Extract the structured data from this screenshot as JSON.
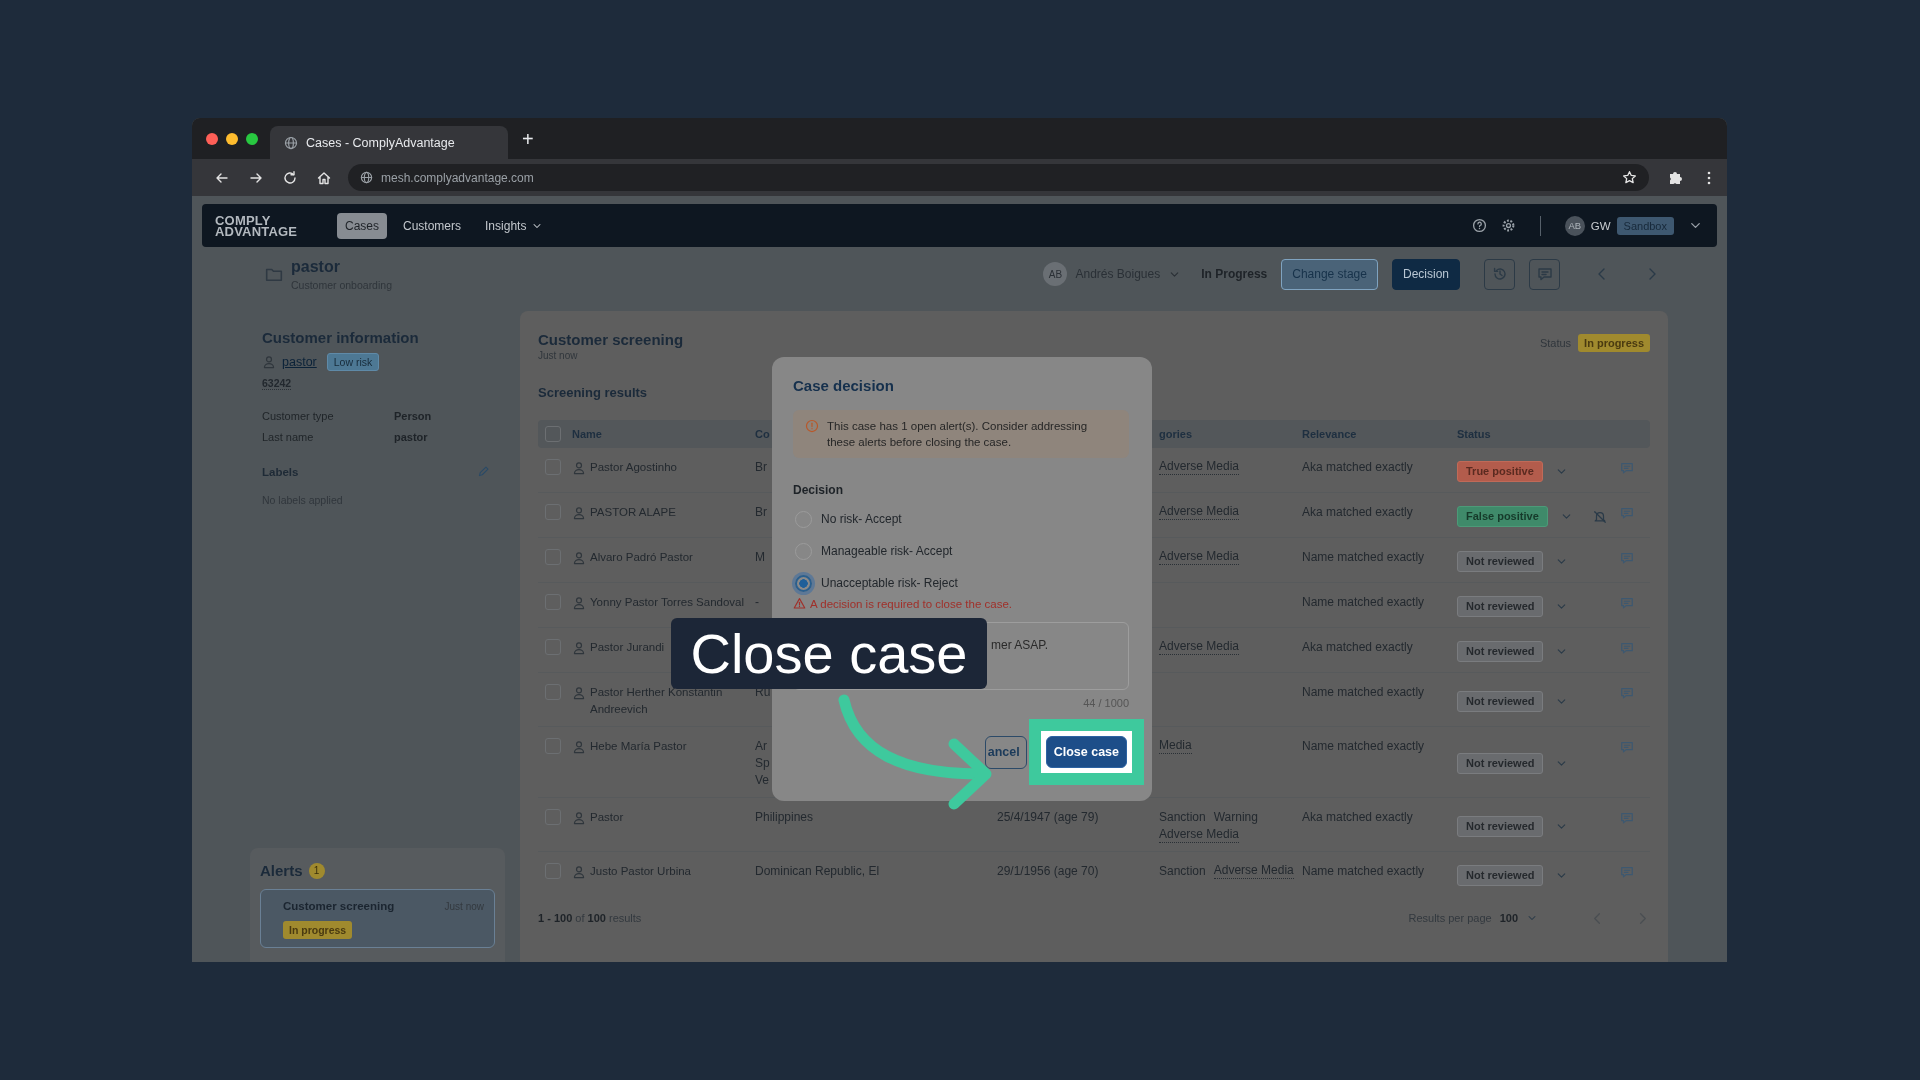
{
  "browser": {
    "tab_title": "Cases - ComplyAdvantage",
    "new_tab": "+",
    "url": "mesh.complyadvantage.com"
  },
  "app_nav": {
    "logo": [
      "COMPLY",
      "ADVANTAGE"
    ],
    "items": [
      {
        "label": "Cases",
        "selected": true,
        "dropdown": false
      },
      {
        "label": "Customers",
        "selected": false,
        "dropdown": false
      },
      {
        "label": "Insights",
        "selected": false,
        "dropdown": true
      }
    ],
    "user_initials": "AB",
    "user_code": "GW",
    "environment": "Sandbox"
  },
  "case_header": {
    "title": "pastor",
    "subtitle": "Customer onboarding",
    "assignee_initials": "AB",
    "assignee": "Andrés Boigues",
    "stage": "In Progress",
    "buttons": [
      {
        "label": "Change stage",
        "kind": "secondary"
      },
      {
        "label": "Decision",
        "kind": "primary"
      }
    ]
  },
  "customer_info": {
    "title": "Customer information",
    "name": "pastor",
    "risk": "Low risk",
    "id": "63242",
    "fields": [
      {
        "label": "Customer type",
        "value": "Person"
      },
      {
        "label": "Last name",
        "value": "pastor"
      }
    ],
    "labels_title": "Labels",
    "labels_empty": "No labels applied"
  },
  "alerts": {
    "title": "Alerts",
    "count": "1",
    "items": [
      {
        "title": "Customer screening",
        "time": "Just now",
        "status": "In progress"
      }
    ]
  },
  "screening": {
    "title": "Customer screening",
    "time": "Just now",
    "status_label": "Status",
    "status": "In progress",
    "results_title": "Screening results",
    "all_checked": false,
    "columns": [
      "Name",
      "Co",
      "gories",
      "Relevance",
      "Status"
    ],
    "rows": [
      {
        "checked": false,
        "name": "Pastor Agostinho",
        "country": "Br",
        "categories": [
          {
            "label": "Adverse Media",
            "link": true
          }
        ],
        "relevance": "Aka matched exactly",
        "status": {
          "label": "True positive",
          "kind": "true_positive"
        },
        "muted": false
      },
      {
        "checked": false,
        "name": "PASTOR ALAPE",
        "country": "Br",
        "categories": [
          {
            "label": "Adverse Media",
            "link": true
          }
        ],
        "relevance": "Aka matched exactly",
        "status": {
          "label": "False positive",
          "kind": "false_positive"
        },
        "muted": true
      },
      {
        "checked": false,
        "name": "Alvaro Padró Pastor",
        "country": "M",
        "categories": [
          {
            "label": "Adverse Media",
            "link": true
          }
        ],
        "relevance": "Name matched exactly",
        "status": {
          "label": "Not reviewed",
          "kind": "not_reviewed"
        },
        "muted": false
      },
      {
        "checked": false,
        "name": "Yonny Pastor Torres Sandoval",
        "country": "-",
        "relevance": "Name matched exactly",
        "status": {
          "label": "Not reviewed",
          "kind": "not_reviewed"
        },
        "muted": false
      },
      {
        "checked": false,
        "name": "Pastor Jurandi",
        "categories": [
          {
            "label": "Adverse Media",
            "link": true
          }
        ],
        "relevance": "Aka matched exactly",
        "status": {
          "label": "Not reviewed",
          "kind": "not_reviewed"
        },
        "muted": false
      },
      {
        "checked": false,
        "name": "Pastor Herther Konstantin Andreevich",
        "country": "Ru",
        "relevance": "Name matched exactly",
        "status": {
          "label": "Not reviewed",
          "kind": "not_reviewed"
        },
        "muted": false
      },
      {
        "checked": false,
        "name": "Hebe María Pastor",
        "country": "Ar\nSp\nVe",
        "categories": [
          {
            "label": "Media",
            "link": true
          }
        ],
        "relevance": "Name matched exactly",
        "status": {
          "label": "Not reviewed",
          "kind": "not_reviewed"
        },
        "muted": false
      },
      {
        "checked": false,
        "name": "Pastor",
        "country": "Philippines",
        "dob": "25/4/1947 (age 79)",
        "categories": [
          {
            "label": "Sanction",
            "link": false
          },
          {
            "label": "Warning",
            "link": false
          },
          {
            "label": "Adverse Media",
            "link": true
          }
        ],
        "relevance": "Aka matched exactly",
        "status": {
          "label": "Not reviewed",
          "kind": "not_reviewed"
        },
        "muted": false
      },
      {
        "checked": false,
        "name": "Justo Pastor Urbina",
        "country": "Dominican Republic, El",
        "dob": "29/1/1956 (age 70)",
        "categories": [
          {
            "label": "Sanction",
            "link": false
          },
          {
            "label": "Adverse Media",
            "link": true
          }
        ],
        "relevance": "Name matched exactly",
        "status": {
          "label": "Not reviewed",
          "kind": "not_reviewed"
        },
        "muted": false
      }
    ],
    "summary": "**1 - 100** of **100** results",
    "per_page_label": "Results per page",
    "per_page": "100"
  },
  "modal": {
    "title": "Case decision",
    "notice": "This case has 1 open alert(s). Consider addressing these alerts before closing the case.",
    "decision_label": "Decision",
    "options": [
      {
        "label": "No risk- Accept",
        "selected": false
      },
      {
        "label": "Manageable risk- Accept",
        "selected": false
      },
      {
        "label": "Unacceptable risk- Reject",
        "selected": true
      }
    ],
    "error": "A decision is required to close the case.",
    "comment": "mer ASAP.",
    "counter": "44 / 1000",
    "buttons": [
      {
        "label": "ancel",
        "kind": "secondary",
        "highlighted": false
      },
      {
        "label": "Close case",
        "kind": "primary",
        "highlighted": true
      }
    ]
  },
  "callout": {
    "text": "Close case"
  }
}
